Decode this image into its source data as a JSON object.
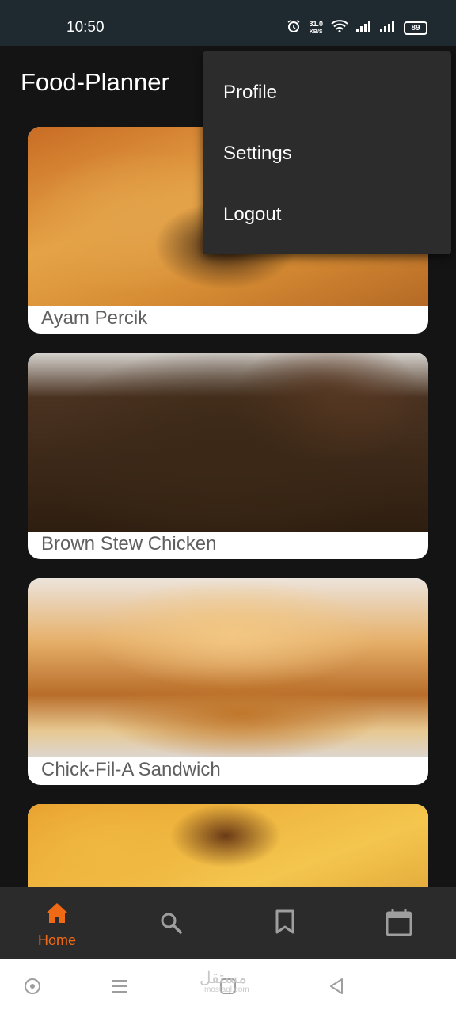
{
  "status_bar": {
    "time": "10:50",
    "net_speed_value": "31.0",
    "net_speed_unit": "KB/S",
    "battery": "89"
  },
  "app_bar": {
    "title": "Food-Planner"
  },
  "menu": {
    "items": [
      {
        "label": "Profile"
      },
      {
        "label": "Settings"
      },
      {
        "label": "Logout"
      }
    ]
  },
  "meals": [
    {
      "name": "Ayam Percik"
    },
    {
      "name": "Brown Stew Chicken"
    },
    {
      "name": "Chick-Fil-A Sandwich"
    },
    {
      "name": ""
    }
  ],
  "bottom_nav": {
    "items": [
      {
        "label": "Home",
        "icon": "home-icon",
        "active": true
      },
      {
        "label": "",
        "icon": "search-icon",
        "active": false
      },
      {
        "label": "",
        "icon": "bookmark-icon",
        "active": false
      },
      {
        "label": "",
        "icon": "calendar-icon",
        "active": false
      }
    ],
    "active_color": "#f06a15",
    "inactive_color": "#9e9e9e"
  },
  "watermark": {
    "text": "مستقل",
    "sub": "mostaql.com"
  }
}
